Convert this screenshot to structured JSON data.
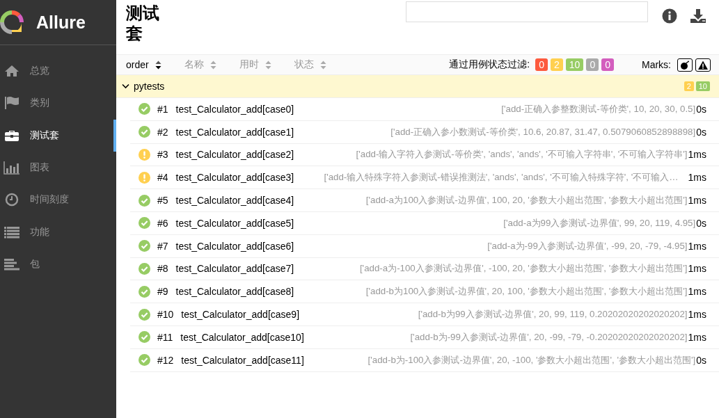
{
  "brand": {
    "name": "Allure"
  },
  "sidebar": {
    "items": [
      {
        "label": "总览",
        "selected": false
      },
      {
        "label": "类别",
        "selected": false
      },
      {
        "label": "测试套",
        "selected": true
      },
      {
        "label": "图表",
        "selected": false
      },
      {
        "label": "时间刻度",
        "selected": false
      },
      {
        "label": "功能",
        "selected": false
      },
      {
        "label": "包",
        "selected": false
      }
    ]
  },
  "header": {
    "title": "测试套"
  },
  "sort_columns": [
    {
      "label": "order",
      "selected": true
    },
    {
      "label": "名称",
      "selected": false
    },
    {
      "label": "用时",
      "selected": false
    },
    {
      "label": "状态",
      "selected": false
    }
  ],
  "status_filter": {
    "label": "通过用例状态过滤:",
    "badges": [
      {
        "count": "0",
        "color": "#fd5a3e"
      },
      {
        "count": "2",
        "color": "#ffd050"
      },
      {
        "count": "10",
        "color": "#97cc64"
      },
      {
        "count": "0",
        "color": "#aaaaaa"
      },
      {
        "count": "0",
        "color": "#d35ebe"
      }
    ]
  },
  "marks": {
    "label": "Marks:",
    "buttons": [
      {
        "kind": "bomb"
      },
      {
        "kind": "warning"
      }
    ]
  },
  "group": {
    "name": "pytests",
    "expanded": true,
    "counts": [
      {
        "count": "2",
        "color": "#ffd050"
      },
      {
        "count": "10",
        "color": "#97cc64"
      }
    ]
  },
  "rows": [
    {
      "kind": "passed",
      "order": "#1",
      "name": "test_Calculator_add[case0]",
      "params": "['add-正确入参整数测试-等价类', 10, 20, 30, 0.5]",
      "duration": "0s"
    },
    {
      "kind": "passed",
      "order": "#2",
      "name": "test_Calculator_add[case1]",
      "params": "['add-正确入参小数测试-等价类', 10.6, 20.87, 31.47, 0.5079060852898898]",
      "duration": "0s"
    },
    {
      "kind": "broken",
      "order": "#3",
      "name": "test_Calculator_add[case2]",
      "params": "['add-输入字符入参测试-等价类', 'ands', 'ands', '不可输入字符串', '不可输入字符串']",
      "duration": "1ms"
    },
    {
      "kind": "broken",
      "order": "#4",
      "name": "test_Calculator_add[case3]",
      "params": "['add-输入特殊字符入参测试-错误推测法', 'ands', 'ands', '不可输入特殊字符', '不可输入…",
      "duration": "1ms"
    },
    {
      "kind": "passed",
      "order": "#5",
      "name": "test_Calculator_add[case4]",
      "params": "['add-a为100入参测试-边界值', 100, 20, '参数大小超出范围', '参数大小超出范围']",
      "duration": "1ms"
    },
    {
      "kind": "passed",
      "order": "#6",
      "name": "test_Calculator_add[case5]",
      "params": "['add-a为99入参测试-边界值', 99, 20, 119, 4.95]",
      "duration": "0s"
    },
    {
      "kind": "passed",
      "order": "#7",
      "name": "test_Calculator_add[case6]",
      "params": "['add-a为-99入参测试-边界值', -99, 20, -79, -4.95]",
      "duration": "1ms"
    },
    {
      "kind": "passed",
      "order": "#8",
      "name": "test_Calculator_add[case7]",
      "params": "['add-a为-100入参测试-边界值', -100, 20, '参数大小超出范围', '参数大小超出范围']",
      "duration": "1ms"
    },
    {
      "kind": "passed",
      "order": "#9",
      "name": "test_Calculator_add[case8]",
      "params": "['add-b为100入参测试-边界值', 20, 100, '参数大小超出范围', '参数大小超出范围']",
      "duration": "1ms"
    },
    {
      "kind": "passed",
      "order": "#10",
      "name": "test_Calculator_add[case9]",
      "params": "['add-b为99入参测试-边界值', 20, 99, 119, 0.20202020202020202]",
      "duration": "1ms"
    },
    {
      "kind": "passed",
      "order": "#11",
      "name": "test_Calculator_add[case10]",
      "params": "['add-b为-99入参测试-边界值', 20, -99, -79, -0.20202020202020202]",
      "duration": "1ms"
    },
    {
      "kind": "passed",
      "order": "#12",
      "name": "test_Calculator_add[case11]",
      "params": "['add-b为-100入参测试-边界值', 20, -100, '参数大小超出范围', '参数大小超出范围']",
      "duration": "0s"
    }
  ]
}
